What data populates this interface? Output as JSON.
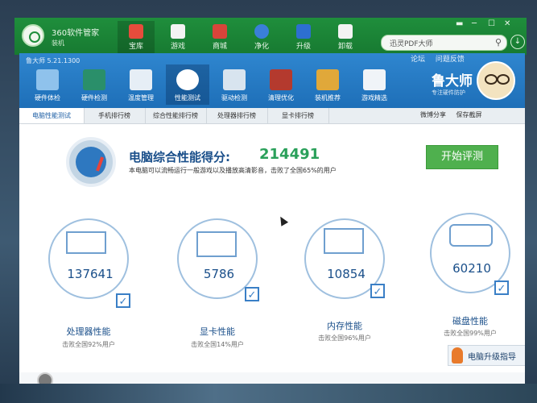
{
  "suite": {
    "brand": "360软件管家",
    "brand_sub": "装机",
    "tabs": [
      {
        "label": "宝库",
        "icon": "treasure-icon",
        "color": "#e74c3c"
      },
      {
        "label": "游戏",
        "icon": "gamepad-icon",
        "color": "#f3f3f3"
      },
      {
        "label": "商城",
        "icon": "mall-icon",
        "color": "#d8443a"
      },
      {
        "label": "净化",
        "icon": "shield-icon",
        "color": "#3a7fd8"
      },
      {
        "label": "升级",
        "icon": "upgrade-icon",
        "color": "#2d6fd0"
      },
      {
        "label": "卸载",
        "icon": "trash-icon",
        "color": "#f3f3f3"
      }
    ],
    "search_text": "迅灵PDF大师",
    "window_controls": [
      "▬",
      "─",
      "☐",
      "✕"
    ]
  },
  "app": {
    "title": "鲁大师 5.21.1300",
    "top_links": [
      "论坛",
      "问题反馈"
    ],
    "toolbar": [
      {
        "label": "硬件体检",
        "icon": "monitor-icon"
      },
      {
        "label": "硬件检测",
        "icon": "chip-icon"
      },
      {
        "label": "温度管理",
        "icon": "thermometer-icon"
      },
      {
        "label": "性能测试",
        "icon": "speedometer-icon"
      },
      {
        "label": "驱动检测",
        "icon": "driver-icon"
      },
      {
        "label": "清理优化",
        "icon": "broom-icon"
      },
      {
        "label": "装机推荐",
        "icon": "cube-icon"
      },
      {
        "label": "游戏精选",
        "icon": "gamepad-icon"
      }
    ],
    "brand_name": "鲁大师",
    "brand_slogan": "专注硬件防护",
    "subtabs": [
      "电脑性能测试",
      "手机排行榜",
      "综合性能排行榜",
      "处理器排行榜",
      "显卡排行榜"
    ],
    "actions": [
      "微博分享",
      "保存截屏"
    ]
  },
  "score": {
    "label": "电脑综合性能得分:",
    "value": "214491",
    "desc": "本电脑可以流畅运行一般游戏以及播放高清影音，击败了全国65%的用户",
    "button": "开始评测"
  },
  "cards": [
    {
      "name": "处理器性能",
      "score": "137641",
      "sub": "击败全国92%用户",
      "icon": "cpu-monitor-icon"
    },
    {
      "name": "显卡性能",
      "score": "5786",
      "sub": "击败全国14%用户",
      "icon": "gpu-icon"
    },
    {
      "name": "内存性能",
      "score": "10854",
      "sub": "击败全国96%用户",
      "icon": "memory-icon"
    },
    {
      "name": "磁盘性能",
      "score": "60210",
      "sub": "击败全国99%用户",
      "icon": "disk-icon"
    }
  ],
  "upgrade_label": "电脑升级指导",
  "colors": {
    "suite_green": "#1f8e3c",
    "app_blue": "#1e6fb8",
    "score_green": "#2aa05a",
    "button_green": "#4fb04e",
    "text_blue": "#1a4f8a"
  }
}
